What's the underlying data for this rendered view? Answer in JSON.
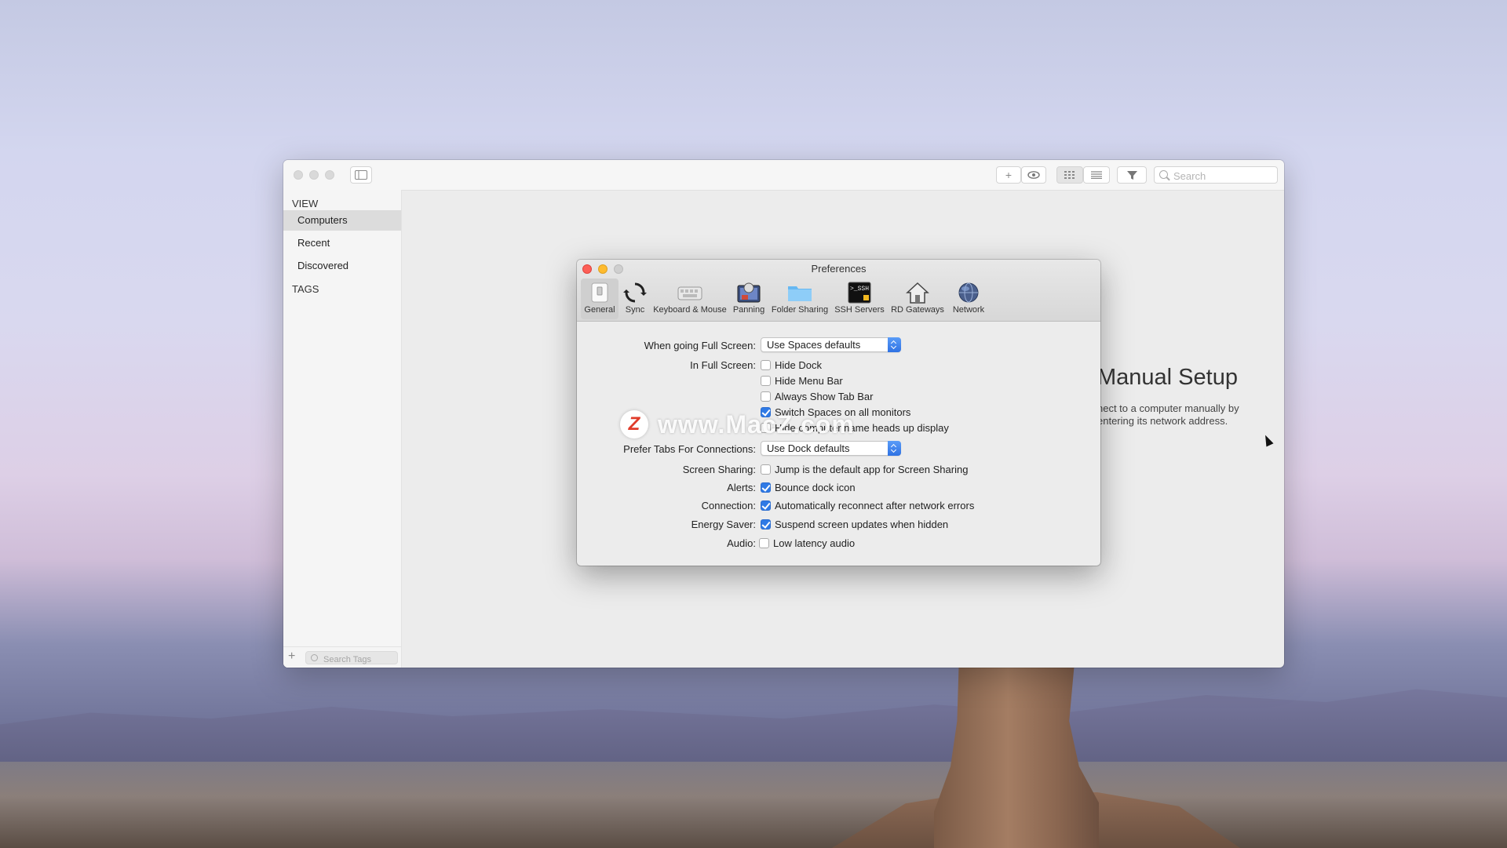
{
  "main_window": {
    "toolbar": {
      "search_placeholder": "Search",
      "add_icon": "plus-icon",
      "eye_icon": "eye-icon",
      "grid_icon": "grid-icon",
      "list_icon": "list-icon",
      "filter_icon": "filter-icon"
    },
    "sidebar": {
      "view_header": "VIEW",
      "items": [
        {
          "label": "Computers",
          "selected": true
        },
        {
          "label": "Recent",
          "selected": false
        },
        {
          "label": "Discovered",
          "selected": false
        }
      ],
      "tags_header": "TAGS",
      "tag_search_placeholder": "Search Tags",
      "add_label": "+"
    },
    "content": {
      "manual_title": "Manual Setup",
      "manual_desc": "nect to a computer manually by entering its network address."
    }
  },
  "preferences": {
    "title": "Preferences",
    "tabs": [
      {
        "label": "General",
        "icon": "switch-icon",
        "selected": true
      },
      {
        "label": "Sync",
        "icon": "sync-icon",
        "selected": false
      },
      {
        "label": "Keyboard & Mouse",
        "icon": "keyboard-icon",
        "selected": false
      },
      {
        "label": "Panning",
        "icon": "panning-icon",
        "selected": false
      },
      {
        "label": "Folder Sharing",
        "icon": "folder-icon",
        "selected": false
      },
      {
        "label": "SSH Servers",
        "icon": "terminal-icon",
        "selected": false
      },
      {
        "label": "RD Gateways",
        "icon": "house-icon",
        "selected": false
      },
      {
        "label": "Network",
        "icon": "globe-icon",
        "selected": false
      }
    ],
    "terminal_text": ">_SSH",
    "labels": {
      "full_screen": "When going Full Screen:",
      "in_full_screen": "In Full Screen:",
      "prefer_tabs": "Prefer Tabs For Connections:",
      "screen_sharing": "Screen Sharing:",
      "alerts": "Alerts:",
      "connection": "Connection:",
      "energy_saver": "Energy Saver:",
      "audio": "Audio:"
    },
    "full_screen_value": "Use Spaces defaults",
    "prefer_tabs_value": "Use Dock defaults",
    "in_full_screen_options": [
      {
        "label": "Hide Dock",
        "checked": false
      },
      {
        "label": "Hide Menu Bar",
        "checked": false
      },
      {
        "label": "Always Show Tab Bar",
        "checked": false
      },
      {
        "label": "Switch Spaces on all monitors",
        "checked": true
      },
      {
        "label": "Hide computer name heads up display",
        "checked": false
      }
    ],
    "screen_sharing_option": {
      "label": "Jump is the default app for Screen Sharing",
      "checked": false
    },
    "alerts_option": {
      "label": "Bounce dock icon",
      "checked": true
    },
    "connection_option": {
      "label": "Automatically reconnect after network errors",
      "checked": true
    },
    "energy_option": {
      "label": "Suspend screen updates when hidden",
      "checked": true
    },
    "audio_option": {
      "label": "Low latency audio",
      "checked": false
    }
  },
  "watermark": {
    "logo": "Z",
    "text": "www.MacZ.com"
  }
}
